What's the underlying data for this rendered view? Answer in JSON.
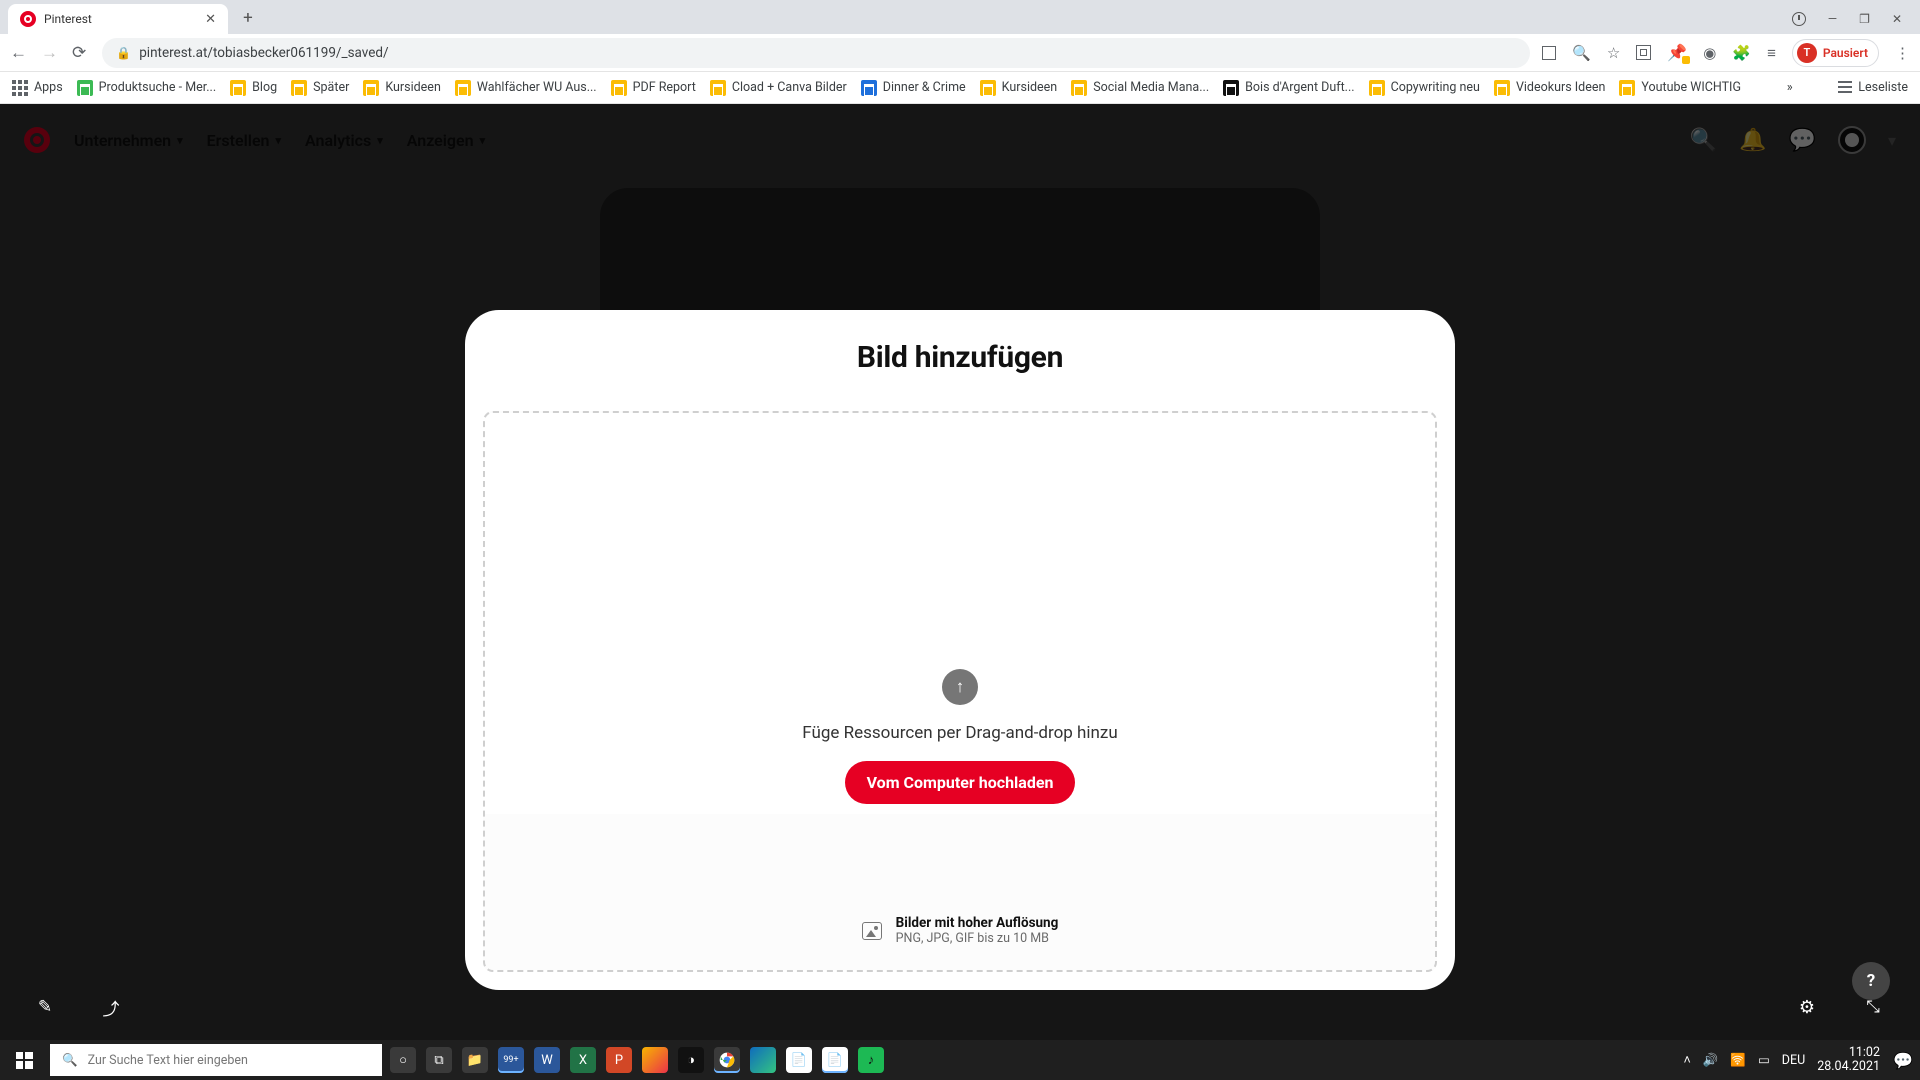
{
  "browser": {
    "tab_title": "Pinterest",
    "url": "pinterest.at/tobiasbecker061199/_saved/",
    "profile_label": "Pausiert",
    "profile_initial": "T",
    "apps_label": "Apps",
    "readlist_label": "Leseliste",
    "bookmarks": [
      "Produktsuche - Mer...",
      "Blog",
      "Später",
      "Kursideen",
      "Wahlfächer WU Aus...",
      "PDF Report",
      "Cload + Canva Bilder",
      "Dinner & Crime",
      "Kursideen",
      "Social Media Mana...",
      "Bois d'Argent Duft...",
      "Copywriting neu",
      "Videokurs Ideen",
      "Youtube WICHTIG"
    ]
  },
  "pin_nav": {
    "items": [
      "Unternehmen",
      "Erstellen",
      "Analytics",
      "Anzeigen"
    ]
  },
  "modal": {
    "title": "Bild hinzufügen",
    "drop_text": "Füge Ressourcen per Drag-and-drop hinzu",
    "upload_button": "Vom Computer hochladen",
    "hint_title": "Bilder mit hoher Auflösung",
    "hint_sub": "PNG, JPG, GIF bis zu 10 MB"
  },
  "taskbar": {
    "search_placeholder": "Zur Suche Text hier eingeben",
    "lang": "DEU",
    "time": "11:02",
    "date": "28.04.2021",
    "pinned_badge": "99+"
  }
}
